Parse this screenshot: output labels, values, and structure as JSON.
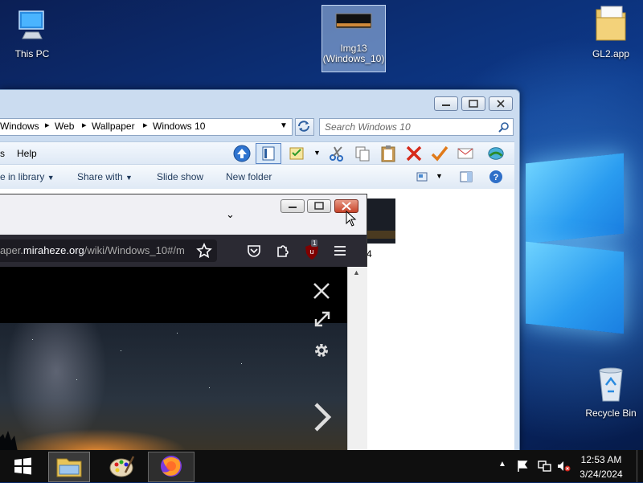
{
  "desktop": {
    "icons": [
      {
        "label": "This PC"
      },
      {
        "label": "Img13 (Windows_10)"
      },
      {
        "label": "GL2.app"
      },
      {
        "label": "Recycle Bin"
      }
    ]
  },
  "explorer": {
    "breadcrumb": [
      "Windows",
      "Web",
      "Wallpaper",
      "Windows 10"
    ],
    "search_placeholder": "Search Windows 10",
    "menu": {
      "partial": "s",
      "help": "Help"
    },
    "commands": {
      "include_library": "e in library",
      "share_with": "Share with",
      "slide_show": "Slide show",
      "new_folder": "New folder"
    },
    "thumbnail_caption": "4"
  },
  "firefox": {
    "url_prefix": "aper.",
    "url_host": "miraheze.org",
    "url_path": "/wiki/Windows_10#/m",
    "addon_badge": "1"
  },
  "taskbar": {
    "time": "12:53 AM",
    "date": "3/24/2024"
  },
  "colors": {
    "taskbar_bg": "#0f0f0f",
    "aero_frame": "#cbdcf0",
    "firefox_toolbar": "#2b2a33",
    "close_red": "#c7432b"
  }
}
